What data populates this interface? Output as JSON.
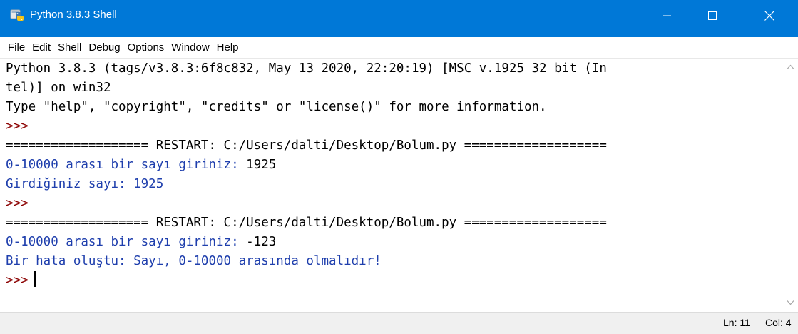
{
  "window": {
    "title": "Python 3.8.3 Shell",
    "accent_color": "#0078d7",
    "app_icon": "python-icon",
    "controls": [
      "minimize-icon",
      "maximize-icon",
      "close-icon"
    ]
  },
  "menu": {
    "items": [
      "File",
      "Edit",
      "Shell",
      "Debug",
      "Options",
      "Window",
      "Help"
    ]
  },
  "shell": {
    "colors": {
      "stdout": "#000000",
      "prompt": "#8b0000",
      "output": "#1f3fad"
    },
    "lines": [
      {
        "segments": [
          {
            "text": "Python 3.8.3 (tags/v3.8.3:6f8c832, May 13 2020, 22:20:19) [MSC v.1925 32 bit (In",
            "style": "stdout"
          }
        ]
      },
      {
        "segments": [
          {
            "text": "tel)] on win32",
            "style": "stdout"
          }
        ]
      },
      {
        "segments": [
          {
            "text": "Type \"help\", \"copyright\", \"credits\" or \"license()\" for more information.",
            "style": "stdout"
          }
        ]
      },
      {
        "segments": [
          {
            "text": ">>>",
            "style": "prompt"
          }
        ]
      },
      {
        "segments": [
          {
            "text": "=================== RESTART: C:/Users/dalti/Desktop/Bolum.py ===================",
            "style": "stdout"
          }
        ]
      },
      {
        "segments": [
          {
            "text": "0-10000 arası bir sayı giriniz: ",
            "style": "output"
          },
          {
            "text": "1925",
            "style": "stdout"
          }
        ]
      },
      {
        "segments": [
          {
            "text": "Girdiğiniz sayı: 1925",
            "style": "output"
          }
        ]
      },
      {
        "segments": [
          {
            "text": ">>>",
            "style": "prompt"
          }
        ]
      },
      {
        "segments": [
          {
            "text": "=================== RESTART: C:/Users/dalti/Desktop/Bolum.py ===================",
            "style": "stdout"
          }
        ]
      },
      {
        "segments": [
          {
            "text": "0-10000 arası bir sayı giriniz: ",
            "style": "output"
          },
          {
            "text": "-123",
            "style": "stdout"
          }
        ]
      },
      {
        "segments": [
          {
            "text": "Bir hata oluştu: Sayı, 0-10000 arasında olmalıdır!",
            "style": "output"
          }
        ]
      },
      {
        "segments": [
          {
            "text": ">>>",
            "style": "prompt"
          }
        ],
        "cursor": true
      }
    ]
  },
  "scrollbar": {
    "up_icon": "chevron-up-icon",
    "down_icon": "chevron-down-icon"
  },
  "status": {
    "line": "Ln: 11",
    "col": "Col: 4"
  }
}
